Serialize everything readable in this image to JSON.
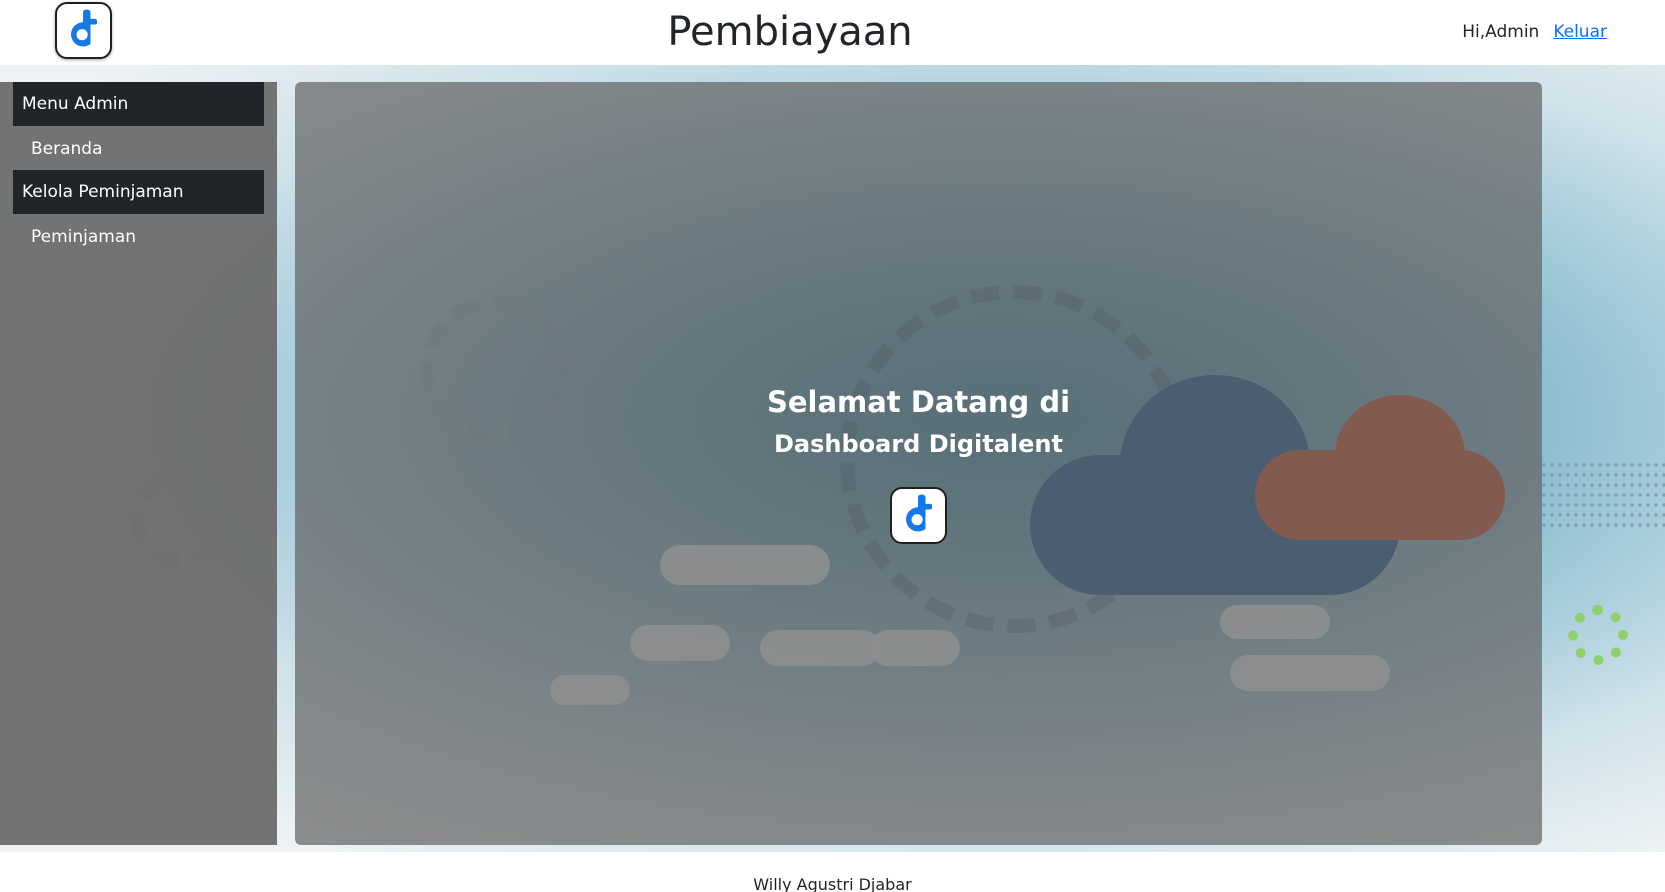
{
  "header": {
    "title": "Pembiayaan",
    "greeting": "Hi,Admin",
    "logout_label": "Keluar",
    "logo_icon": "digitalent-logo-icon"
  },
  "sidebar": {
    "sections": [
      {
        "header": "Menu Admin",
        "items": [
          "Beranda"
        ]
      },
      {
        "header": "Kelola Peminjaman",
        "items": [
          "Peminjaman"
        ]
      }
    ]
  },
  "main": {
    "welcome_line1": "Selamat Datang di",
    "welcome_line2": "Dashboard Digitalent",
    "logo_icon": "digitalent-logo-icon"
  },
  "footer": {
    "text": "Willy Agustri Djabar"
  },
  "colors": {
    "menu_header_bg": "#212529",
    "link": "#0d6efd",
    "logo_blue": "#1479e6"
  }
}
